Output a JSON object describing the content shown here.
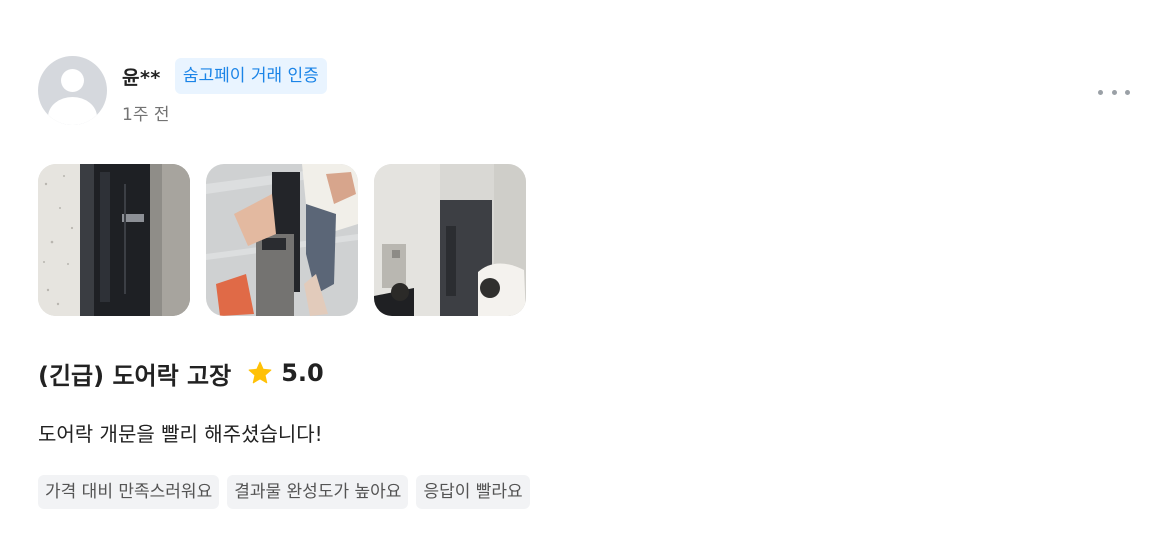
{
  "review": {
    "author": "윤**",
    "badge": "숨고페이 거래 인증",
    "time_ago": "1주 전",
    "more_icon": "more-horizontal-icon",
    "photos": [
      {
        "name": "photo-door-lock-closeup"
      },
      {
        "name": "photo-door-lock-handheld"
      },
      {
        "name": "photo-hallway-door"
      }
    ],
    "title": "(긴급) 도어락 고장",
    "rating": "5.0",
    "star_color": "#FFC107",
    "body": "도어락 개문을 빨리 해주셨습니다!",
    "tags": [
      "가격 대비 만족스러워요",
      "결과물 완성도가 높아요",
      "응답이 빨라요"
    ]
  },
  "colors": {
    "badge_bg": "#E9F4FF",
    "badge_text": "#1B84E7",
    "tag_bg": "#F2F3F5",
    "tag_text": "#545454"
  }
}
